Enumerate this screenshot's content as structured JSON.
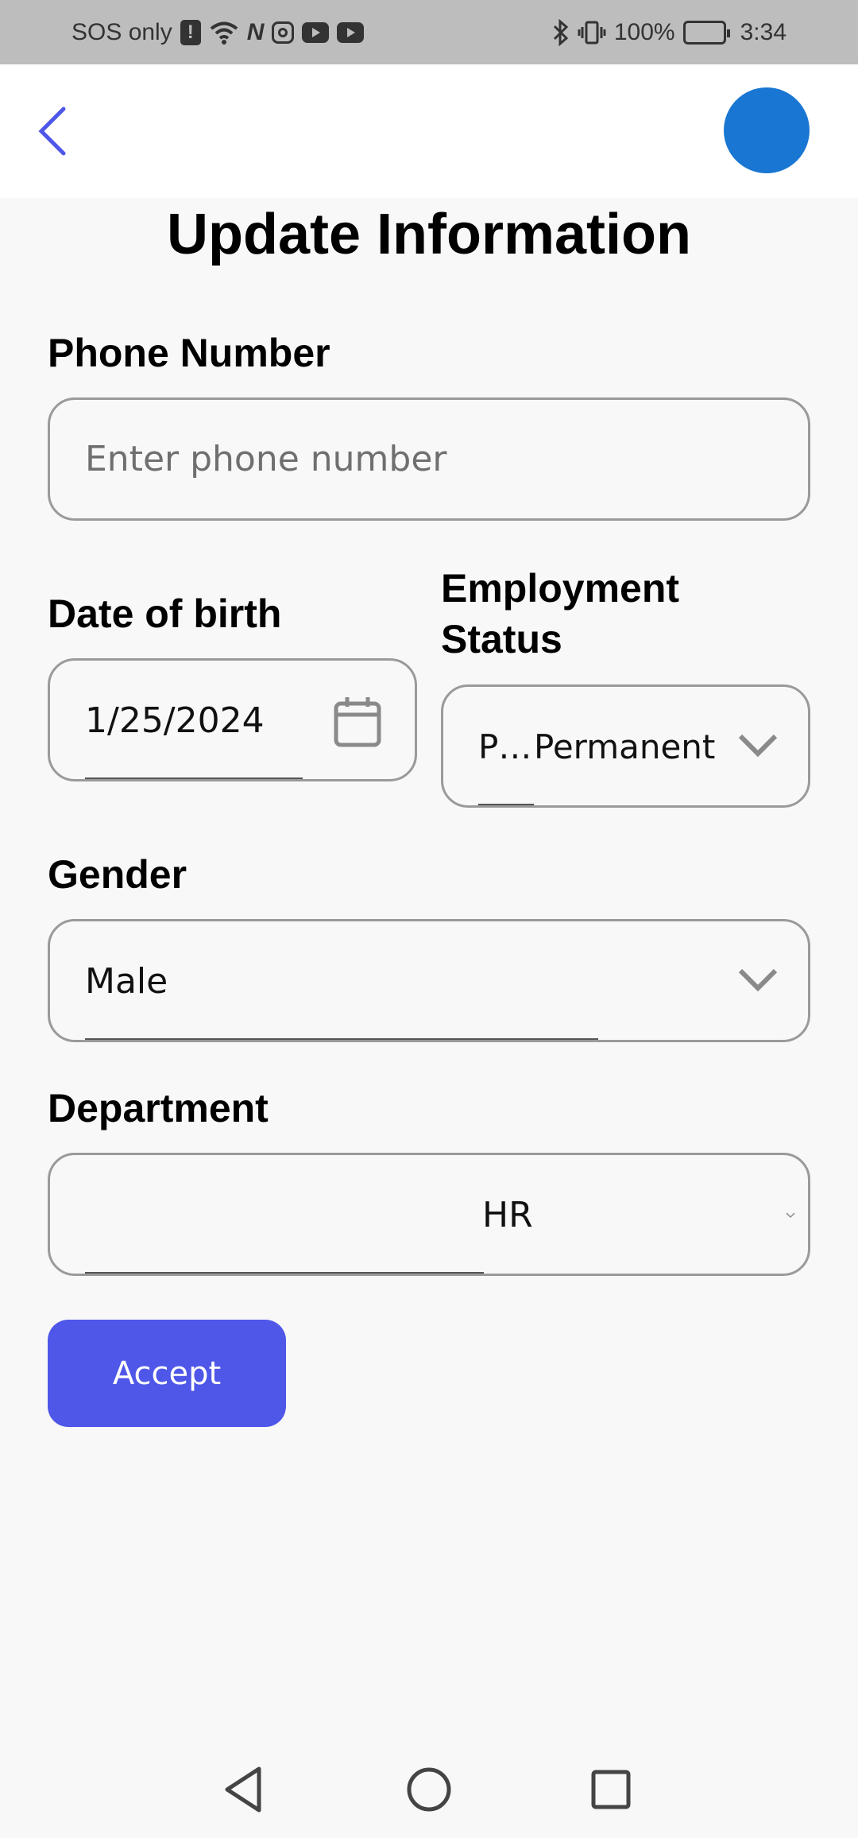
{
  "status_bar": {
    "carrier_text": "SOS only",
    "battery_text": "100%",
    "time": "3:34",
    "icons": [
      "alert-icon",
      "wifi-icon",
      "nfc-icon",
      "instagram-icon",
      "youtube-icon",
      "youtube-icon",
      "bluetooth-icon",
      "vibrate-icon",
      "battery-icon"
    ]
  },
  "app_bar": {
    "back_icon": "chevron-left-icon",
    "avatar_color": "#1976d2",
    "accent_color": "#4f57e8"
  },
  "form": {
    "title": "Update Information",
    "phone": {
      "label": "Phone Number",
      "placeholder": "Enter phone number",
      "value": ""
    },
    "dob": {
      "label": "Date of birth",
      "value": "1/25/2024",
      "icon": "calendar-icon"
    },
    "employment_status": {
      "label_line1": "Employment",
      "label_line2": "Status",
      "prefix": "P…",
      "value": "Permanent",
      "icon": "chevron-down-icon"
    },
    "gender": {
      "label": "Gender",
      "value": "Male",
      "icon": "chevron-down-icon"
    },
    "department": {
      "label": "Department",
      "value": "HR",
      "icon": "chevron-down-icon"
    },
    "accept_label": "Accept"
  },
  "nav_bar": {
    "back_icon": "nav-back-icon",
    "home_icon": "nav-home-icon",
    "recents_icon": "nav-recents-icon"
  }
}
